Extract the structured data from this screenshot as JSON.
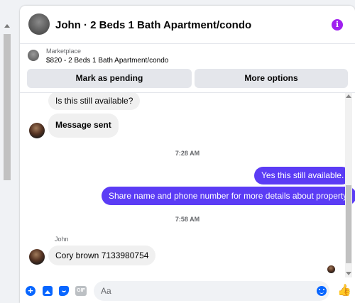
{
  "header": {
    "title": "John · 2 Beds 1 Bath Apartment/condo",
    "info_icon": "i"
  },
  "marketplace": {
    "source": "Marketplace",
    "listing": "$820 - 2 Beds 1 Bath Apartment/condo",
    "mark_pending_label": "Mark as pending",
    "more_options_label": "More options"
  },
  "messages": [
    {
      "text": "Is this still available?",
      "direction": "in"
    },
    {
      "text": "Message sent",
      "direction": "in"
    },
    {
      "text": "Yes this still available.",
      "direction": "out"
    },
    {
      "text": "Share name and phone number for more details about property.",
      "direction": "out"
    },
    {
      "text": "Cory brown 7133980754",
      "direction": "in"
    }
  ],
  "timestamps": [
    "7:28 AM",
    "7:58 AM"
  ],
  "sender_name": "John",
  "composer": {
    "placeholder": "Aa",
    "gif_label": "GIF",
    "plus_glyph": "+"
  },
  "colors": {
    "outgoing_bubble": "#5b3cf5",
    "incoming_bubble": "#f0f0f0",
    "accent_blue": "#0866ff",
    "info_purple": "#a020f0"
  }
}
